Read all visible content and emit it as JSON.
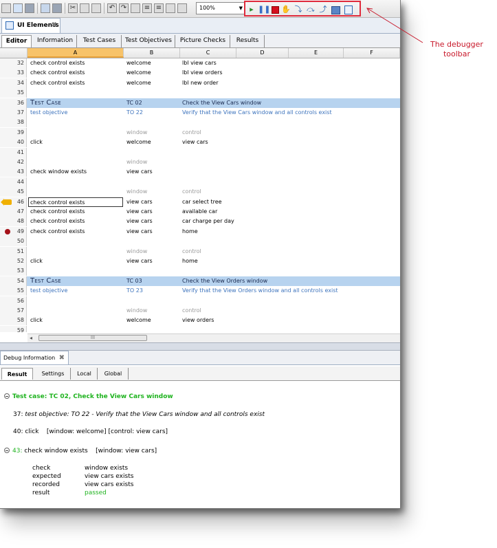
{
  "toolbar": {
    "zoom": "100%",
    "debugger_buttons": [
      "resume-icon",
      "pause-icon",
      "stop-icon",
      "hand-icon",
      "step-into-icon",
      "step-over-icon",
      "step-out-icon",
      "breakpoint-window-icon",
      "debug-info-icon"
    ]
  },
  "doc_tab": {
    "label": "UI Elements"
  },
  "editor_tabs": [
    "Editor",
    "Information",
    "Test Cases",
    "Test Objectives",
    "Picture Checks",
    "Results"
  ],
  "columns": [
    "A",
    "B",
    "C",
    "D",
    "E",
    "F"
  ],
  "rows": [
    {
      "n": "32",
      "a": "check control exists",
      "b": "welcome",
      "c": "lbl view cars",
      "style": ""
    },
    {
      "n": "33",
      "a": "check control exists",
      "b": "welcome",
      "c": "lbl view orders",
      "style": ""
    },
    {
      "n": "34",
      "a": "check control exists",
      "b": "welcome",
      "c": "lbl new order",
      "style": ""
    },
    {
      "n": "35",
      "a": "",
      "b": "",
      "c": "",
      "style": ""
    },
    {
      "n": "36",
      "a": "Test Case",
      "b": "TC 02",
      "c": "Check the View Cars window",
      "style": "tc"
    },
    {
      "n": "37",
      "a": "test objective",
      "b": "TO 22",
      "c": "Verify that the View Cars window and all controls exist",
      "style": "obj"
    },
    {
      "n": "38",
      "a": "",
      "b": "",
      "c": "",
      "style": ""
    },
    {
      "n": "39",
      "a": "",
      "b": "window",
      "c": "control",
      "style": "hdr"
    },
    {
      "n": "40",
      "a": "click",
      "b": "welcome",
      "c": "view cars",
      "style": ""
    },
    {
      "n": "41",
      "a": "",
      "b": "",
      "c": "",
      "style": ""
    },
    {
      "n": "42",
      "a": "",
      "b": "window",
      "c": "",
      "style": "hdr"
    },
    {
      "n": "43",
      "a": "check window exists",
      "b": "view cars",
      "c": "",
      "style": ""
    },
    {
      "n": "44",
      "a": "",
      "b": "",
      "c": "",
      "style": ""
    },
    {
      "n": "45",
      "a": "",
      "b": "window",
      "c": "control",
      "style": "hdr"
    },
    {
      "n": "46",
      "a": "check control exists",
      "b": "view cars",
      "c": "car select tree",
      "style": "sel",
      "marker": "arrow"
    },
    {
      "n": "47",
      "a": "check control exists",
      "b": "view cars",
      "c": "available car",
      "style": ""
    },
    {
      "n": "48",
      "a": "check control exists",
      "b": "view cars",
      "c": "car charge per day",
      "style": ""
    },
    {
      "n": "49",
      "a": "check control exists",
      "b": "view cars",
      "c": "home",
      "style": "",
      "marker": "dot"
    },
    {
      "n": "50",
      "a": "",
      "b": "",
      "c": "",
      "style": ""
    },
    {
      "n": "51",
      "a": "",
      "b": "window",
      "c": "control",
      "style": "hdr"
    },
    {
      "n": "52",
      "a": "click",
      "b": "view cars",
      "c": "home",
      "style": ""
    },
    {
      "n": "53",
      "a": "",
      "b": "",
      "c": "",
      "style": ""
    },
    {
      "n": "54",
      "a": "Test Case",
      "b": "TC 03",
      "c": "Check the View Orders window",
      "style": "tc"
    },
    {
      "n": "55",
      "a": "test objective",
      "b": "TO 23",
      "c": "Verify that the View Orders window and all controls exist",
      "style": "obj"
    },
    {
      "n": "56",
      "a": "",
      "b": "",
      "c": "",
      "style": ""
    },
    {
      "n": "57",
      "a": "",
      "b": "window",
      "c": "control",
      "style": "hdr"
    },
    {
      "n": "58",
      "a": "click",
      "b": "welcome",
      "c": "view orders",
      "style": ""
    },
    {
      "n": "59",
      "a": "",
      "b": "",
      "c": "",
      "style": ""
    }
  ],
  "scrollbar": {
    "thumb_glyph": "III"
  },
  "debug_panel": {
    "tab_label": "Debug Information",
    "tabs": [
      "Result",
      "Settings",
      "Local",
      "Global"
    ],
    "test_case_line": "Test case: TC 02, Check the View Cars window",
    "objective_line_num": "37:",
    "objective_line": "test objective: TO 22 - Verify that the View Cars window and all controls exist",
    "click_line_num": "40:",
    "click_line": "click    [window: welcome] [control: view cars]",
    "check_line_num": "43:",
    "check_line": "check window exists    [window: view cars]",
    "details": [
      {
        "label": "check",
        "value": "window exists"
      },
      {
        "label": "expected",
        "value": "view cars exists"
      },
      {
        "label": "recorded",
        "value": "view cars exists"
      },
      {
        "label": "result",
        "value": "passed"
      }
    ]
  },
  "annotation": "The debugger toolbar"
}
